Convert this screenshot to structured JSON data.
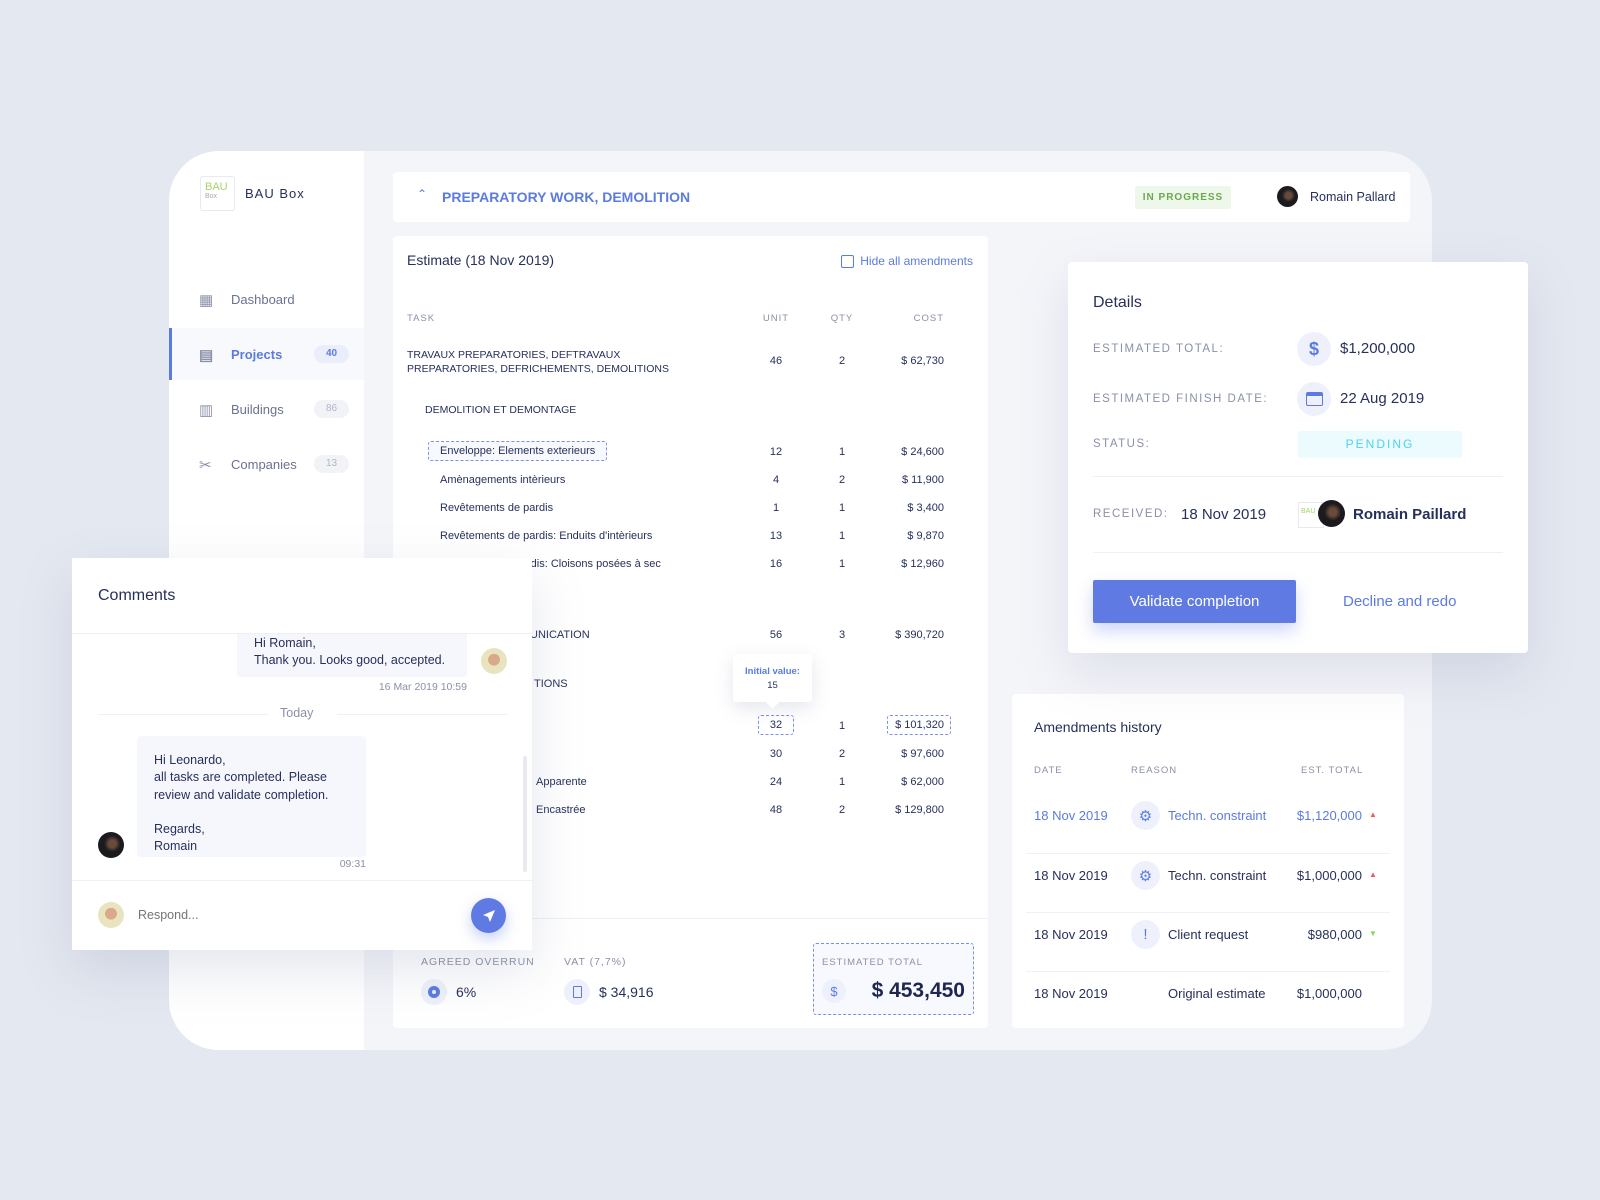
{
  "app": {
    "logo_text": "BAU",
    "logo_sub": "Box",
    "name": "BAU Box"
  },
  "sidebar": {
    "items": [
      {
        "label": "Dashboard",
        "icon": "grid-icon"
      },
      {
        "label": "Projects",
        "icon": "document-icon",
        "badge": "40",
        "active": true
      },
      {
        "label": "Buildings",
        "icon": "building-icon",
        "badge": "86"
      },
      {
        "label": "Companies",
        "icon": "tools-icon",
        "badge": "13"
      }
    ]
  },
  "header": {
    "title": "PREPARATORY WORK, DEMOLITION",
    "status": "IN PROGRESS",
    "user": "Romain Pallard"
  },
  "estimate": {
    "title": "Estimate (18 Nov 2019)",
    "hide_amendments": "Hide all amendments",
    "columns": [
      "TASK",
      "UNIT",
      "QTY",
      "COST"
    ],
    "rows": [
      {
        "task": "TRAVAUX PREPARATORIES, DEFTRAVAUX PREPARATORIES, DEFRICHEMENTS, DEMOLITIONS",
        "unit": "46",
        "qty": "2",
        "cost": "$ 62,730"
      },
      {
        "task": "DEMOLITION ET DEMONTAGE",
        "unit": "",
        "qty": "",
        "cost": ""
      },
      {
        "task": "Enveloppe: Elements exterieurs",
        "unit": "12",
        "qty": "1",
        "cost": "$ 24,600",
        "amended": "task"
      },
      {
        "task": "Amènagements intèrieurs",
        "unit": "4",
        "qty": "2",
        "cost": "$ 11,900"
      },
      {
        "task": "Revêtements de pardis",
        "unit": "1",
        "qty": "1",
        "cost": "$ 3,400"
      },
      {
        "task": "Revêtements de pardis: Enduits d'intèrieurs",
        "unit": "13",
        "qty": "1",
        "cost": "$ 9,870"
      },
      {
        "task": "rdis: Cloisons posées à sec",
        "unit": "16",
        "qty": "1",
        "cost": "$ 12,960"
      },
      {
        "task": "UNICATION",
        "unit": "56",
        "qty": "3",
        "cost": "$ 390,720"
      },
      {
        "task": "TIONS",
        "unit": "",
        "qty": "",
        "cost": ""
      },
      {
        "task": "",
        "unit": "32",
        "qty": "1",
        "cost": "$ 101,320",
        "amended": "unit-cost"
      },
      {
        "task": "",
        "unit": "30",
        "qty": "2",
        "cost": "$ 97,600"
      },
      {
        "task": "Apparente",
        "unit": "24",
        "qty": "1",
        "cost": "$ 62,000"
      },
      {
        "task": "Encastrée",
        "unit": "48",
        "qty": "2",
        "cost": "$ 129,800"
      }
    ],
    "tooltip": {
      "label": "Initial value:",
      "value": "15"
    },
    "footer": {
      "overrun_label": "AGREED OVERRUN",
      "overrun_value": "6%",
      "vat_label": "VAT (7,7%)",
      "vat_value": "$ 34,916",
      "total_label": "ESTIMATED TOTAL",
      "total_value": "$ 453,450"
    }
  },
  "details": {
    "title": "Details",
    "estimated_total_label": "ESTIMATED TOTAL:",
    "estimated_total": "$1,200,000",
    "finish_date_label": "ESTIMATED FINISH DATE:",
    "finish_date": "22 Aug 2019",
    "status_label": "STATUS:",
    "status": "PENDING",
    "received_label": "RECEIVED:",
    "received_date": "18 Nov 2019",
    "received_by": "Romain Paillard",
    "validate_button": "Validate completion",
    "decline_link": "Decline and redo"
  },
  "amendments": {
    "title": "Amendments history",
    "columns": [
      "DATE",
      "REASON",
      "EST. TOTAL"
    ],
    "rows": [
      {
        "date": "18 Nov 2019",
        "reason": "Techn. constraint",
        "icon": "gear-icon",
        "total": "$1,120,000",
        "trend": "up",
        "selected": true
      },
      {
        "date": "18 Nov 2019",
        "reason": "Techn. constraint",
        "icon": "gear-icon",
        "total": "$1,000,000",
        "trend": "up"
      },
      {
        "date": "18 Nov 2019",
        "reason": "Client request",
        "icon": "chat-alert-icon",
        "total": "$980,000",
        "trend": "down"
      },
      {
        "date": "18 Nov 2019",
        "reason": "Original estimate",
        "icon": "",
        "total": "$1,000,000",
        "trend": ""
      }
    ]
  },
  "comments": {
    "title": "Comments",
    "messages": [
      {
        "lines": [
          "Hi Romain,",
          "Thank you. Looks good, accepted."
        ],
        "time": "16 Mar 2019 10:59"
      },
      {
        "lines": [
          "Hi Leonardo,",
          "all tasks are completed. Please",
          "review and validate completion.",
          "",
          "Regards,",
          "Romain"
        ],
        "time": "09:31"
      }
    ],
    "divider": "Today",
    "placeholder": "Respond..."
  },
  "colors": {
    "accent": "#5b7be0",
    "background": "#e4e8f0",
    "in_progress": "#6aa84f",
    "pending": "#4fd1f0",
    "up": "#ef5a5a",
    "down": "#7ed957"
  }
}
